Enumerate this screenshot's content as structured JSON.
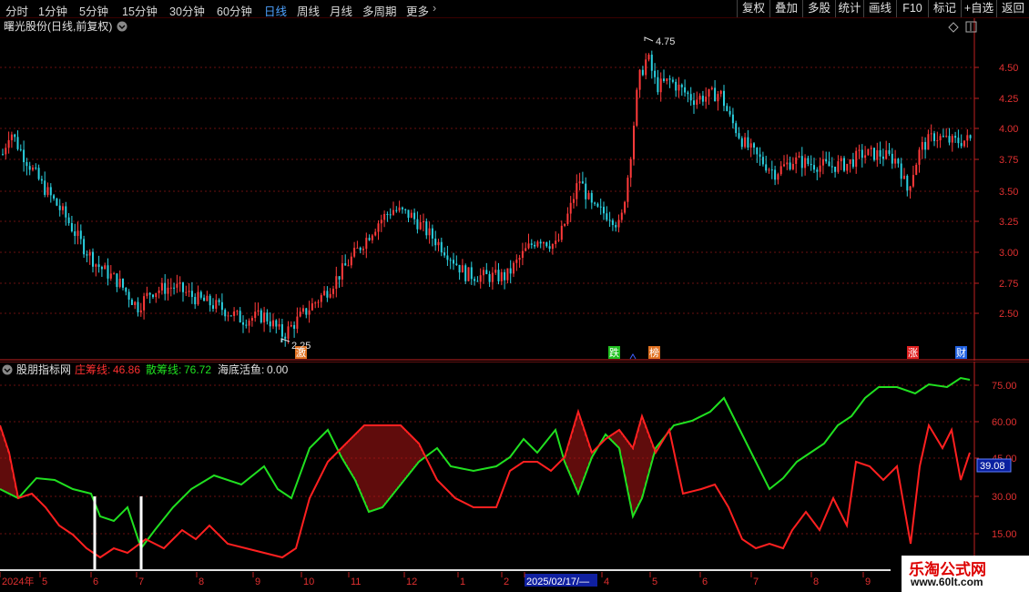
{
  "toolbar": {
    "periods": [
      "分时",
      "1分钟",
      "5分钟",
      "15分钟",
      "30分钟",
      "60分钟",
      "日线",
      "周线",
      "月线",
      "多周期",
      "更多"
    ],
    "active": "日线",
    "buttons": [
      "复权",
      "叠加",
      "多股",
      "统计",
      "画线",
      "F10",
      "标记",
      "+自选",
      "返回"
    ]
  },
  "main": {
    "title": "曙光股份(日线,前复权)",
    "y_ticks": [
      "4.50",
      "4.25",
      "4.00",
      "3.75",
      "3.50",
      "3.25",
      "3.00",
      "2.75",
      "2.50"
    ],
    "high_label": "4.75",
    "low_label": "2.25",
    "markers": [
      {
        "text": "激",
        "color": "#e07020"
      },
      {
        "text": "跌",
        "color": "#20c020"
      },
      {
        "text": "榜",
        "color": "#e07020"
      },
      {
        "text": "涨",
        "color": "#e02020"
      },
      {
        "text": "财",
        "color": "#2060e0"
      }
    ]
  },
  "indicator": {
    "name": "股朋指标网",
    "line1_label": "庄筹线:",
    "line1_value": "46.86",
    "line2_label": "散筹线:",
    "line2_value": "76.72",
    "line3_label": "海底活鱼:",
    "line3_value": "0.00",
    "y_ticks": [
      "75.00",
      "60.00",
      "45.00",
      "30.00",
      "15.00"
    ],
    "current_value": "39.08"
  },
  "date_axis": {
    "labels": [
      "2024年",
      "5",
      "6",
      "7",
      "8",
      "9",
      "10",
      "11",
      "12",
      "1",
      "2",
      "2025/02/17/—",
      "4",
      "5",
      "6",
      "7",
      "8",
      "9"
    ]
  },
  "watermark": {
    "name": "乐淘公式网",
    "url": "www.60lt.com"
  },
  "colors": {
    "up": "#ff3a3a",
    "down": "#2ad0e0",
    "zhuang": "#ff2020",
    "san": "#20e020",
    "grid": "#6a1010",
    "axis": "#c02020"
  }
}
